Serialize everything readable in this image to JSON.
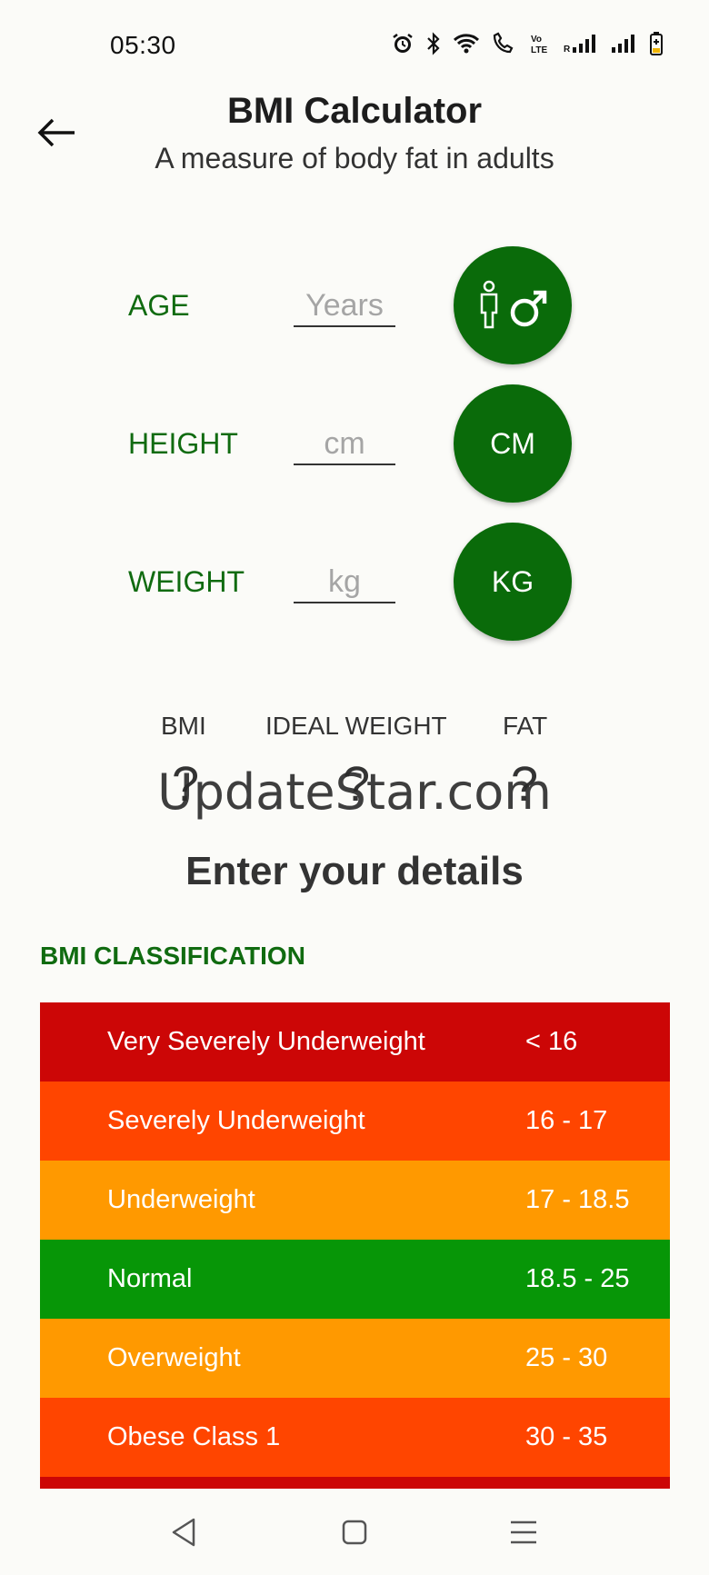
{
  "status_bar": {
    "time": "05:30"
  },
  "header": {
    "title": "BMI Calculator",
    "subtitle": "A measure of body fat in adults"
  },
  "form": {
    "age": {
      "label": "AGE",
      "placeholder": "Years",
      "value": ""
    },
    "height": {
      "label": "HEIGHT",
      "placeholder": "cm",
      "value": "",
      "unit": "CM"
    },
    "weight": {
      "label": "WEIGHT",
      "placeholder": "kg",
      "value": "",
      "unit": "KG"
    },
    "gender_icon": "male-gender-icon"
  },
  "results": {
    "bmi": {
      "label": "BMI",
      "value": "?"
    },
    "ideal_weight": {
      "label": "IDEAL WEIGHT",
      "value": "?"
    },
    "fat": {
      "label": "FAT",
      "value": "?"
    }
  },
  "watermark": "UpdateStar.com",
  "prompt": "Enter your details",
  "classification": {
    "title": "BMI CLASSIFICATION",
    "rows": [
      {
        "name": "Very Severely Underweight",
        "range": "< 16",
        "color": "#cc0606"
      },
      {
        "name": "Severely Underweight",
        "range": "16 - 17",
        "color": "#ff4500"
      },
      {
        "name": "Underweight",
        "range": "17 - 18.5",
        "color": "#ff9900"
      },
      {
        "name": "Normal",
        "range": "18.5 - 25",
        "color": "#079607"
      },
      {
        "name": "Overweight",
        "range": "25 - 30",
        "color": "#ff9900"
      },
      {
        "name": "Obese Class 1",
        "range": "30 - 35",
        "color": "#ff4500"
      },
      {
        "name": "",
        "range": "",
        "color": "#cc0606"
      }
    ]
  },
  "colors": {
    "accent": "#0a6b0a",
    "background": "#fbfbf8"
  }
}
